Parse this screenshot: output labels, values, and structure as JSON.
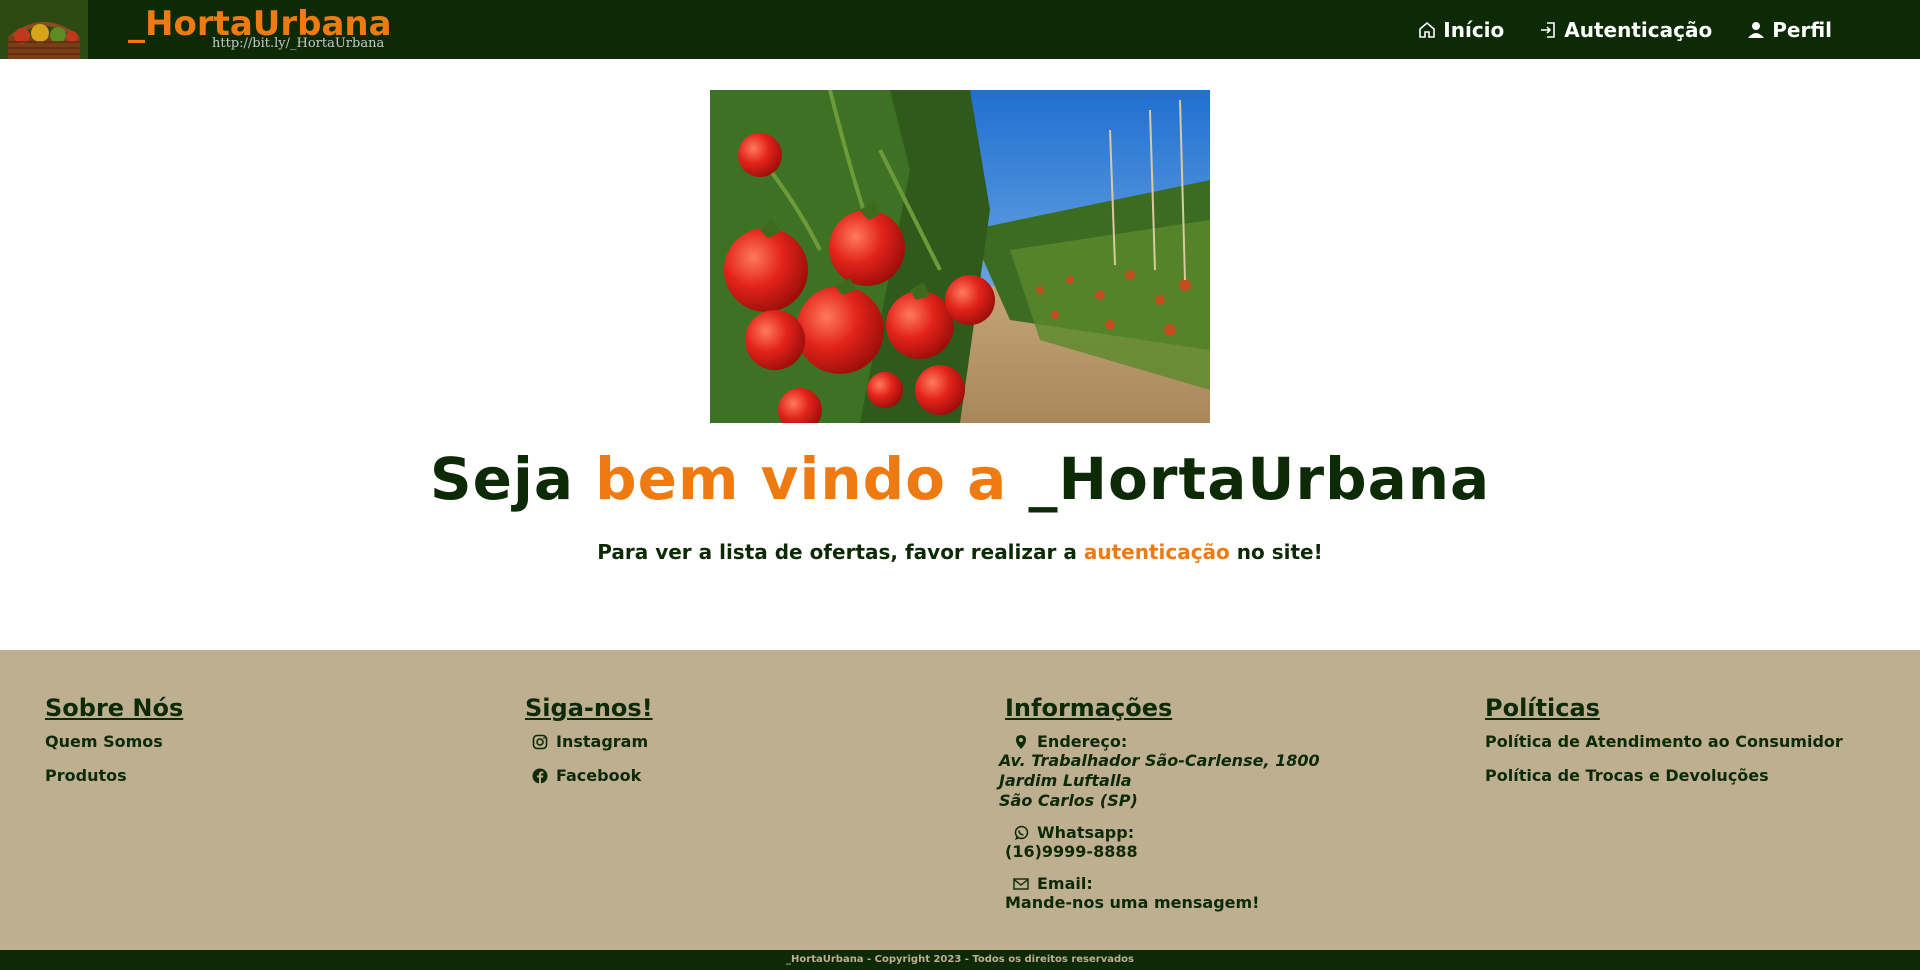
{
  "header": {
    "brand": "_HortaUrbana",
    "brand_url": "http://bit.ly/_HortaUrbana",
    "nav": [
      {
        "label": "Início",
        "icon": "home-icon"
      },
      {
        "label": "Autenticação",
        "icon": "login-icon"
      },
      {
        "label": "Perfil",
        "icon": "user-icon"
      }
    ]
  },
  "main": {
    "headline_part1": "Seja ",
    "headline_part2": "bem vindo a",
    "headline_part3": " _HortaUrbana",
    "sub_part1": "Para ver a lista de ofertas, favor realizar a ",
    "sub_link": "autenticação",
    "sub_part2": " no site!"
  },
  "footer": {
    "about": {
      "title": "Sobre Nós",
      "items": [
        "Quem Somos",
        "Produtos"
      ]
    },
    "follow": {
      "title": "Siga-nos!",
      "items": [
        {
          "label": "Instagram",
          "icon": "instagram-icon"
        },
        {
          "label": "Facebook",
          "icon": "facebook-icon"
        }
      ]
    },
    "info": {
      "title": "Informações",
      "address_label": "Endereço:",
      "address_lines": [
        "Av. Trabalhador São-Carlense, 1800",
        "Jardim Luftalla",
        "São Carlos (SP)"
      ],
      "whatsapp_label": "Whatsapp:",
      "whatsapp_value": "(16)9999-8888",
      "email_label": "Email:",
      "email_value": "Mande-nos uma mensagem!"
    },
    "policies": {
      "title": "Políticas",
      "items": [
        "Política de Atendimento ao Consumidor",
        "Política de Trocas e Devoluções"
      ]
    },
    "copyright": "_HortaUrbana - Copyright 2023 - Todos os direitos reservados"
  },
  "colors": {
    "dark_green": "#0d2a07",
    "accent_orange": "#ee7a12",
    "footer_beige": "#bfaf91"
  }
}
